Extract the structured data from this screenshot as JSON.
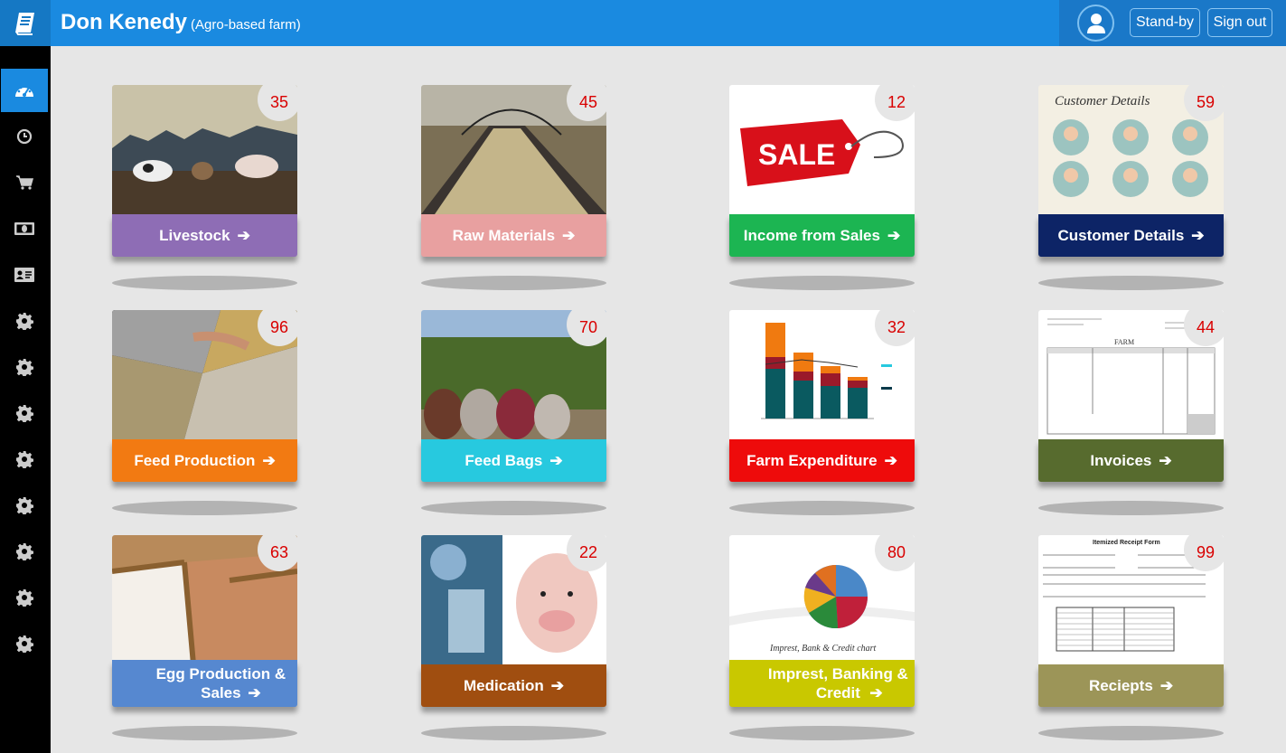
{
  "header": {
    "title": "Don Kenedy",
    "subtitle": "(Agro-based farm)",
    "standby_label": "Stand-by",
    "signout_label": "Sign out"
  },
  "sidebar": {
    "items": [
      {
        "icon": "dashboard-icon",
        "active": true
      },
      {
        "icon": "clock-icon"
      },
      {
        "icon": "cart-icon"
      },
      {
        "icon": "money-icon"
      },
      {
        "icon": "id-card-icon"
      },
      {
        "icon": "gear-icon"
      },
      {
        "icon": "gear-icon"
      },
      {
        "icon": "gear-icon"
      },
      {
        "icon": "gear-icon"
      },
      {
        "icon": "gear-icon"
      },
      {
        "icon": "gear-icon"
      },
      {
        "icon": "gear-icon"
      },
      {
        "icon": "gear-icon"
      }
    ]
  },
  "cards": [
    {
      "label": "Livestock",
      "count": "35",
      "color": "#8e6db5"
    },
    {
      "label": "Raw Materials",
      "count": "45",
      "color": "#e8a0a0"
    },
    {
      "label": "Income from Sales",
      "count": "12",
      "color": "#1cb552"
    },
    {
      "label": "Customer Details",
      "count": "59",
      "color": "#0d2466"
    },
    {
      "label": "Feed Production",
      "count": "96",
      "color": "#f27a12"
    },
    {
      "label": "Feed Bags",
      "count": "70",
      "color": "#27c9df"
    },
    {
      "label": "Farm Expenditure",
      "count": "32",
      "color": "#ee0b0b"
    },
    {
      "label": "Invoices",
      "count": "44",
      "color": "#576b2e"
    },
    {
      "label": "Egg Production & Sales",
      "count": "63",
      "color": "#5688d0"
    },
    {
      "label": "Medication",
      "count": "22",
      "color": "#a04e10"
    },
    {
      "label": "Imprest, Banking & Credit",
      "count": "80",
      "color": "#c9c800"
    },
    {
      "label": "Reciepts",
      "count": "99",
      "color": "#9c9558"
    }
  ],
  "images": {
    "sale_tag_text": "SALE",
    "customer_details_title": "Customer Details",
    "invoice_header": "FARM",
    "pie_caption": "Imprest, Bank & Credit chart",
    "receipt_title": "Itemized Receipt Form"
  }
}
